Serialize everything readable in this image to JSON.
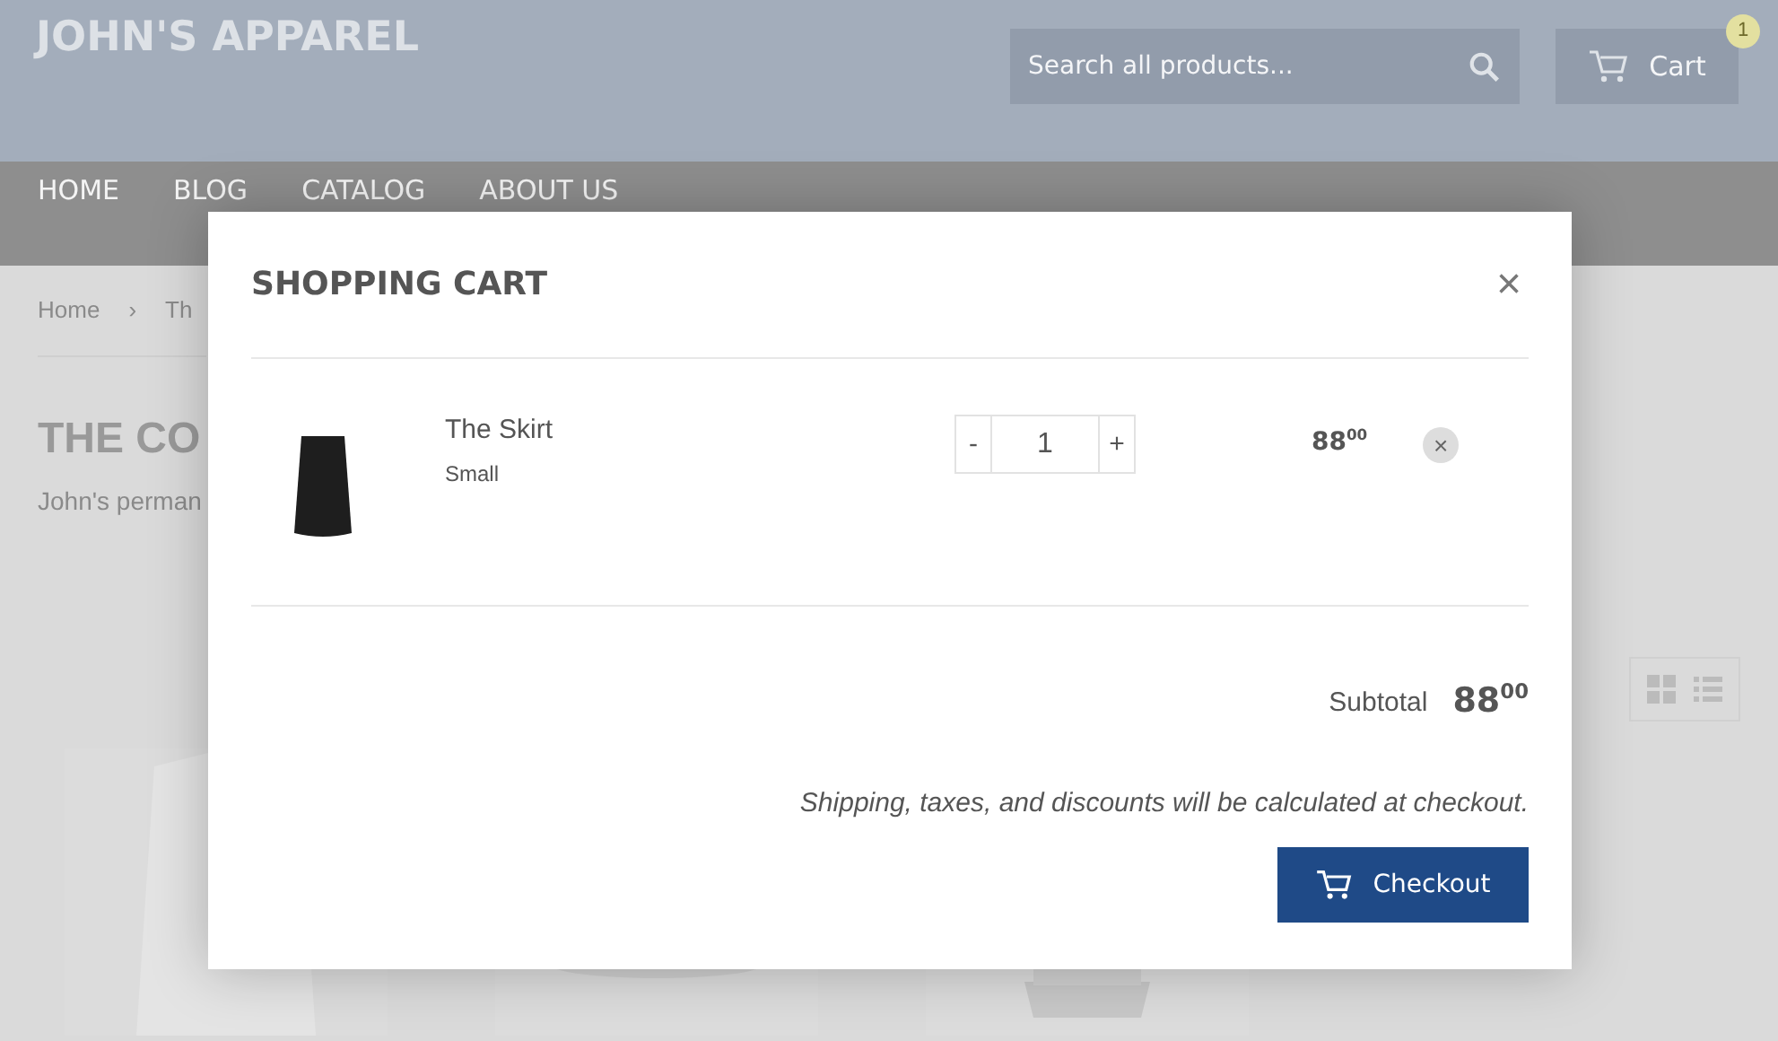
{
  "header": {
    "logo": "JOHN'S APPAREL",
    "search": {
      "placeholder": "Search all products..."
    },
    "cart": {
      "label": "Cart",
      "count": "1"
    }
  },
  "nav": [
    {
      "label": "HOME"
    },
    {
      "label": "BLOG"
    },
    {
      "label": "CATALOG"
    },
    {
      "label": "ABOUT US"
    }
  ],
  "breadcrumb": [
    "Home",
    "›",
    "Th"
  ],
  "view_options": [
    {
      "kind": "grid",
      "selected": false
    },
    {
      "kind": "list",
      "selected": false
    }
  ],
  "collection": {
    "title": "THE CO",
    "description": "John's perman"
  },
  "products": [
    {
      "kind": "picture"
    },
    {
      "kind": "picture"
    },
    {
      "kind": "picture"
    }
  ],
  "cart_modal": {
    "title": "SHOPPING CART",
    "close": "×",
    "items": [
      {
        "name": "The Skirt",
        "variant": "Small",
        "quantity": "1",
        "decrease": "-",
        "increase": "+",
        "price": "88$^{00}$",
        "remove": "×"
      }
    ],
    "subtotal_label": "Subtotal",
    "subtotal": "88$^{00}$",
    "note": "Shipping, taxes, and discounts will be calculated at checkout.",
    "checkout": "Checkout"
  }
}
